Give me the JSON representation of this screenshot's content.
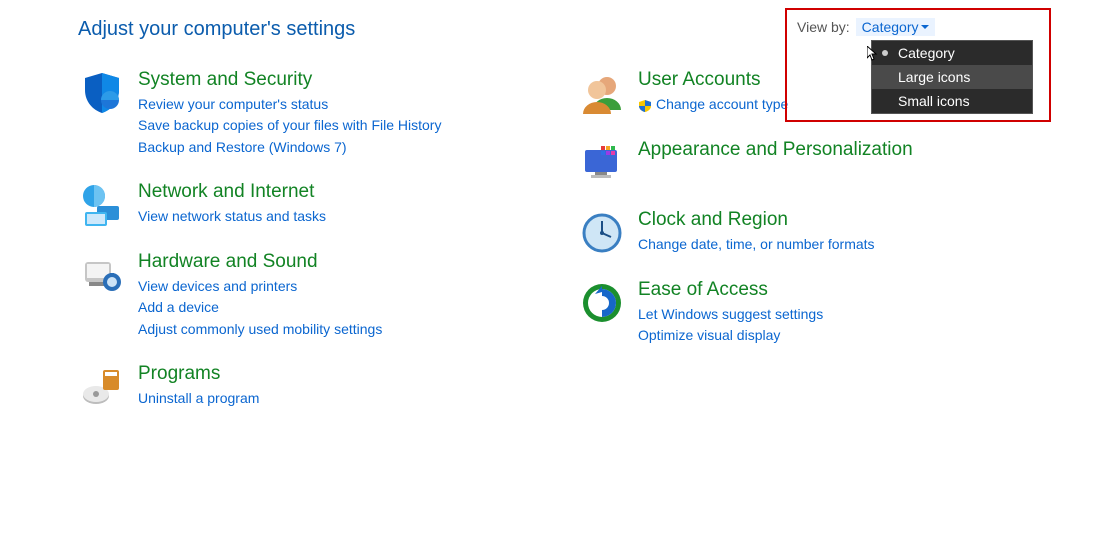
{
  "title": "Adjust your computer's settings",
  "viewby": {
    "label": "View by:",
    "selected": "Category",
    "options": [
      "Category",
      "Large icons",
      "Small icons"
    ],
    "highlighted_index": 1
  },
  "left_column": [
    {
      "title": "System and Security",
      "icon": "shield-system-icon",
      "links": [
        "Review your computer's status",
        "Save backup copies of your files with File History",
        "Backup and Restore (Windows 7)"
      ]
    },
    {
      "title": "Network and Internet",
      "icon": "network-icon",
      "links": [
        "View network status and tasks"
      ]
    },
    {
      "title": "Hardware and Sound",
      "icon": "hardware-icon",
      "links": [
        "View devices and printers",
        "Add a device",
        "Adjust commonly used mobility settings"
      ]
    },
    {
      "title": "Programs",
      "icon": "programs-icon",
      "links": [
        "Uninstall a program"
      ]
    }
  ],
  "right_column": [
    {
      "title": "User Accounts",
      "icon": "users-icon",
      "links": [
        "Change account type"
      ],
      "shielded": [
        0
      ]
    },
    {
      "title": "Appearance and Personalization",
      "icon": "appearance-icon",
      "links": []
    },
    {
      "title": "Clock and Region",
      "icon": "clock-icon",
      "links": [
        "Change date, time, or number formats"
      ]
    },
    {
      "title": "Ease of Access",
      "icon": "ease-icon",
      "links": [
        "Let Windows suggest settings",
        "Optimize visual display"
      ]
    }
  ]
}
